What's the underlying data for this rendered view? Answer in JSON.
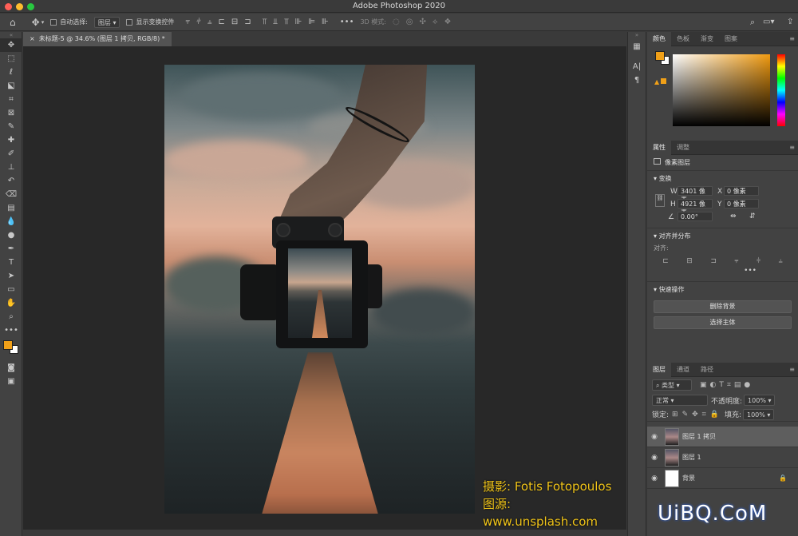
{
  "window": {
    "title": "Adobe Photoshop 2020"
  },
  "options_bar": {
    "auto_select_label": "自动选择:",
    "auto_select_value": "图层",
    "show_transform_label": "显示变换控件",
    "mode_3d_label": "3D 模式:"
  },
  "document": {
    "tab_title": "未标题-5 @ 34.6% (图层 1 拷贝, RGB/8) *"
  },
  "credit": {
    "line1": "摄影: Fotis Fotopoulos",
    "line2": "图源: www.unsplash.com"
  },
  "color_panel": {
    "tabs": [
      "颜色",
      "色板",
      "渐变",
      "图案"
    ],
    "foreground": "#f0a018",
    "background": "#ffffff"
  },
  "properties": {
    "tabs": [
      "属性",
      "调整"
    ],
    "layer_type": "像素图层",
    "transform_label": "变换",
    "w_label": "W",
    "w_value": "3401 像素",
    "h_label": "H",
    "h_value": "4921 像素",
    "x_label": "X",
    "x_value": "0 像素",
    "y_label": "Y",
    "y_value": "0 像素",
    "angle_value": "0.00°",
    "align_label": "对齐并分布",
    "align_sub": "对齐:",
    "quick_actions_label": "快速操作",
    "remove_bg_button": "删除背景",
    "select_subject_button": "选择主体"
  },
  "layers": {
    "tabs": [
      "图层",
      "通道",
      "路径"
    ],
    "filter_label": "类型",
    "blend_mode": "正常",
    "opacity_label": "不透明度:",
    "opacity_value": "100%",
    "lock_label": "锁定:",
    "fill_label": "填充:",
    "fill_value": "100%",
    "items": [
      {
        "name": "图层 1 拷贝",
        "selected": true
      },
      {
        "name": "图层 1",
        "selected": false
      },
      {
        "name": "背景",
        "selected": false
      }
    ]
  },
  "watermark": {
    "text": "UiBQ.CoM"
  }
}
